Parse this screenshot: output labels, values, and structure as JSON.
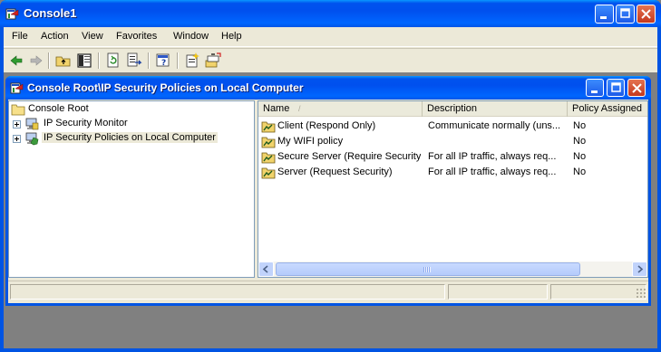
{
  "app": {
    "title": "Console1",
    "icon": "mmc-console-icon"
  },
  "caption_buttons": [
    "minimize",
    "maximize",
    "close"
  ],
  "menu": [
    "File",
    "Action",
    "View",
    "Favorites",
    "Window",
    "Help"
  ],
  "toolbar": [
    "back-arrow-icon",
    "forward-arrow-icon",
    "up-folder-icon",
    "show-hide-tree-icon",
    "refresh-icon",
    "export-list-icon",
    "help-icon",
    "create-policy-icon",
    "manage-filters-icon"
  ],
  "child": {
    "title": "Console Root\\IP Security Policies on Local Computer",
    "tree": {
      "root": "Console Root",
      "items": [
        {
          "label": "IP Security Monitor",
          "selected": false
        },
        {
          "label": "IP Security Policies on Local Computer",
          "selected": true
        }
      ]
    },
    "list": {
      "columns": [
        "Name",
        "Description",
        "Policy Assigned"
      ],
      "sort_indicator": "/",
      "rows": [
        {
          "name": "Client (Respond Only)",
          "description": "Communicate normally (uns...",
          "assigned": "No"
        },
        {
          "name": "My WIFI policy",
          "description": "",
          "assigned": "No"
        },
        {
          "name": "Secure Server (Require Security)",
          "description": "For all IP traffic, always req...",
          "assigned": "No"
        },
        {
          "name": "Server (Request Security)",
          "description": "For all IP traffic, always req...",
          "assigned": "No"
        }
      ],
      "scroll_position": 0.0
    }
  },
  "colors": {
    "titlebar": "#0054e3",
    "face": "#ece9d8",
    "mdi_background": "#808080",
    "close_button": "#c4381d"
  }
}
